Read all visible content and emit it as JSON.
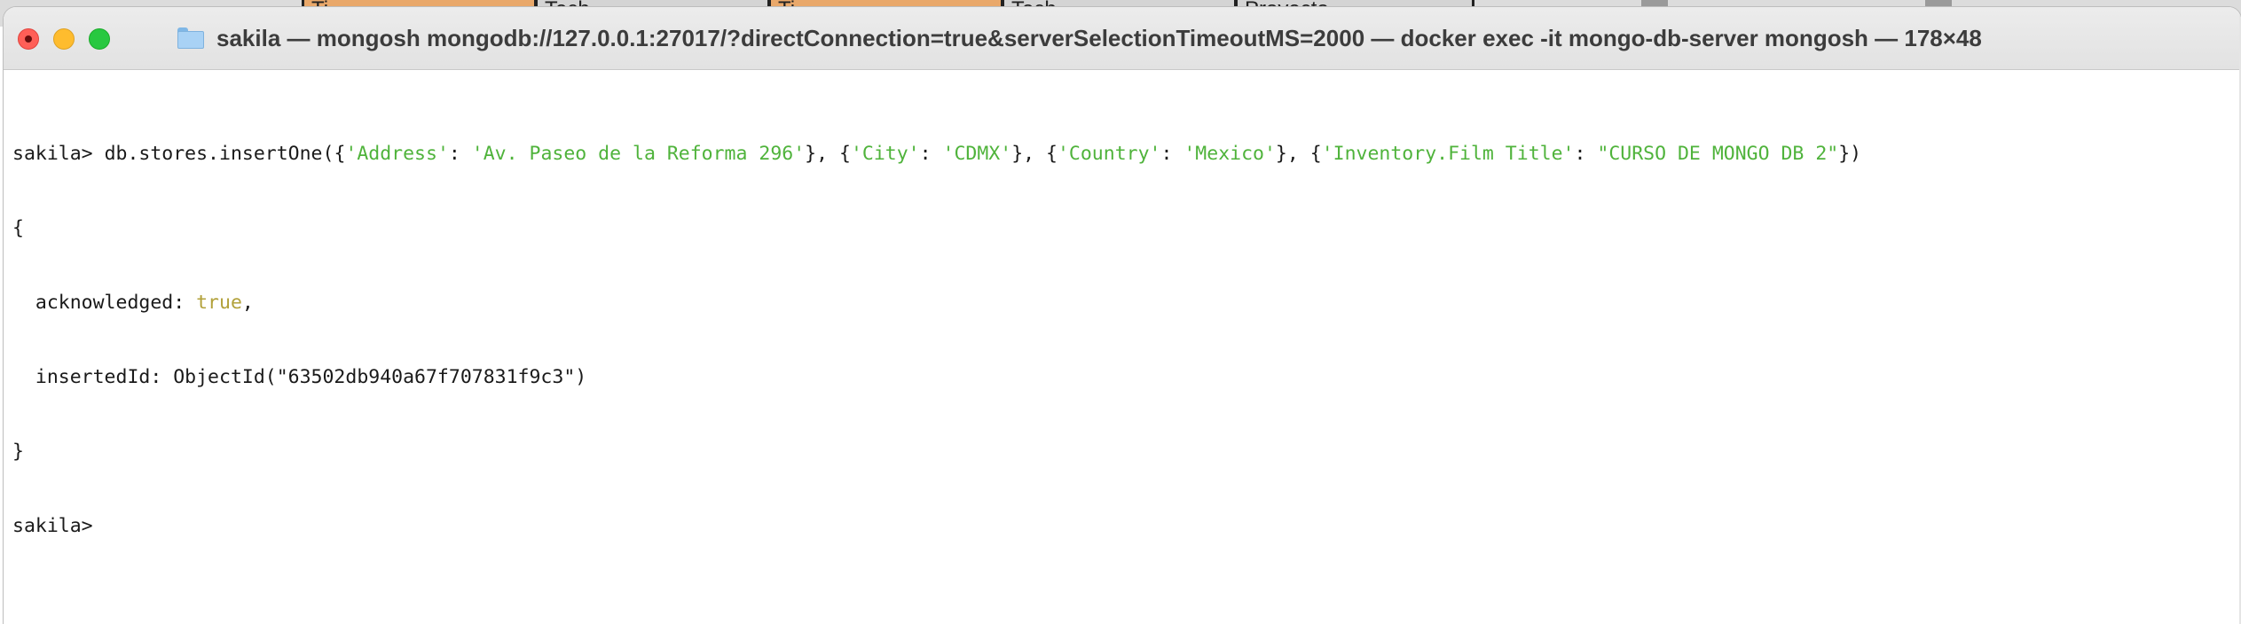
{
  "background_window": {
    "cells": [
      {
        "text": "Ti",
        "color": "#e9a86a"
      },
      {
        "text": "Tech...",
        "color": "#d4d4d4"
      },
      {
        "text": "Ti",
        "color": "#e9a86a"
      },
      {
        "text": "Tech...",
        "color": "#d4d4d4"
      },
      {
        "text": "Proyecto",
        "color": "#d4d4d4"
      }
    ]
  },
  "window": {
    "title": "sakila — mongosh mongodb://127.0.0.1:27017/?directConnection=true&serverSelectionTimeoutMS=2000 — docker exec -it mongo-db-server mongosh — 178×48",
    "controls": {
      "close": "#ff5f57",
      "minimize": "#febc2e",
      "maximize": "#28c840"
    }
  },
  "terminal": {
    "prompt": "sakila> ",
    "command": {
      "prefix": "db.stores.insertOne({",
      "k1": "'Address'",
      "sep1": ": ",
      "v1": "'Av. Paseo de la Reforma 296'",
      "mid1": "}, {",
      "k2": "'City'",
      "sep2": ": ",
      "v2": "'CDMX'",
      "mid2": "}, {",
      "k3": "'Country'",
      "sep3": ": ",
      "v3": "'Mexico'",
      "mid3": "}, {",
      "k4": "'Inventory.Film Title'",
      "sep4": ": ",
      "v4": "\"CURSO DE MONGO DB 2\"",
      "suffix": "})"
    },
    "output": {
      "open_brace": "{",
      "ack_key": "  acknowledged: ",
      "ack_value": "true",
      "ack_comma": ",",
      "id_line": "  insertedId: ObjectId(\"63502db940a67f707831f9c3\")",
      "close_brace": "}"
    },
    "final_prompt": "sakila> ",
    "colors": {
      "string": "#4fb33b",
      "boolean": "#b2a13a",
      "text": "#1a1a1a"
    }
  }
}
